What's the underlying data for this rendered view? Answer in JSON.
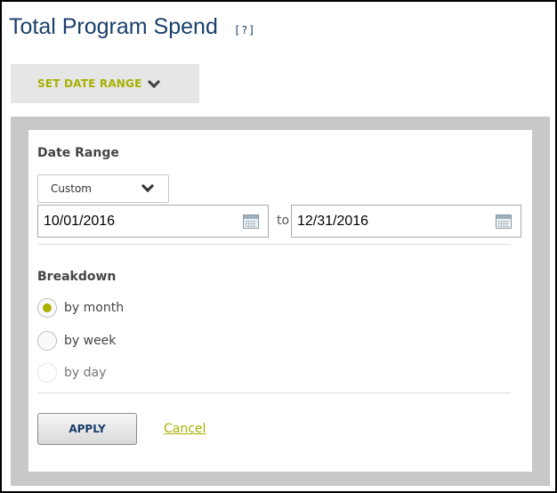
{
  "header": {
    "title": "Total Program Spend",
    "help_label": "[?]"
  },
  "date_range_toggle": {
    "label": "SET DATE RANGE",
    "icon": "chevron-down-icon"
  },
  "date_range": {
    "heading": "Date Range",
    "preset": {
      "selected": "Custom"
    },
    "start_date": "10/01/2016",
    "to_label": "to",
    "end_date": "12/31/2016"
  },
  "breakdown": {
    "heading": "Breakdown",
    "options": [
      {
        "label": "by month",
        "checked": true
      },
      {
        "label": "by week",
        "checked": false
      },
      {
        "label": "by day",
        "checked": false
      }
    ]
  },
  "actions": {
    "apply_label": "APPLY",
    "cancel_label": "Cancel"
  },
  "colors": {
    "title": "#1b3f6b",
    "accent": "#a8b000",
    "panel_border": "#c8c8c8"
  }
}
